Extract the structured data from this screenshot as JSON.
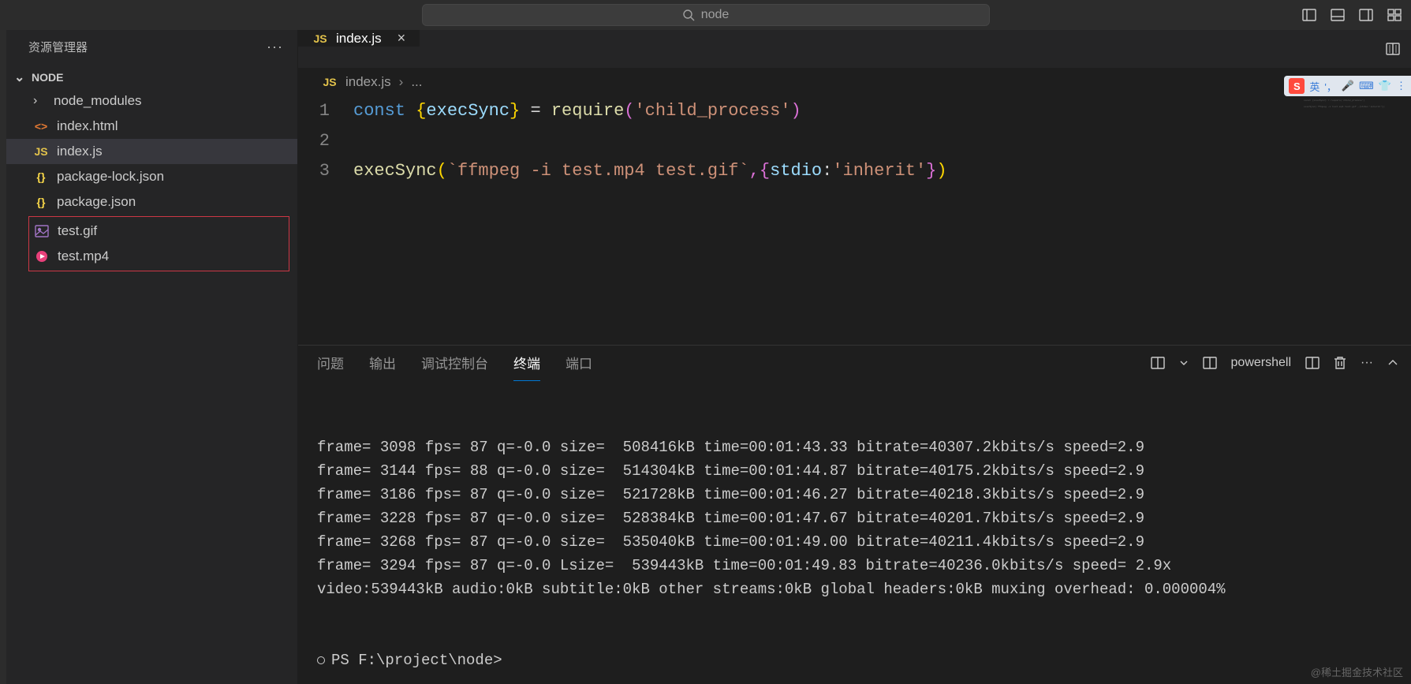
{
  "titlebar": {
    "search_icon": "search",
    "search_text": "node"
  },
  "sidebar": {
    "title": "资源管理器",
    "root_name": "NODE",
    "files": [
      {
        "name": "node_modules",
        "type": "folder",
        "icon": "chevron-right"
      },
      {
        "name": "index.html",
        "type": "html",
        "icon": "<>"
      },
      {
        "name": "index.js",
        "type": "js",
        "icon": "JS",
        "selected": true
      },
      {
        "name": "package-lock.json",
        "type": "json",
        "icon": "{}"
      },
      {
        "name": "package.json",
        "type": "json",
        "icon": "{}"
      }
    ],
    "highlighted_files": [
      {
        "name": "test.gif",
        "type": "image",
        "icon": "img"
      },
      {
        "name": "test.mp4",
        "type": "video",
        "icon": "play"
      }
    ]
  },
  "tabs": [
    {
      "icon": "JS",
      "label": "index.js",
      "active": true
    }
  ],
  "breadcrumbs": {
    "icon": "JS",
    "file": "index.js",
    "rest": "..."
  },
  "code": {
    "lines": [
      {
        "num": "1",
        "tokens": [
          {
            "t": "const ",
            "c": "tok-keyword"
          },
          {
            "t": "{",
            "c": "tok-punct-bracket"
          },
          {
            "t": "execSync",
            "c": "tok-var"
          },
          {
            "t": "}",
            "c": "tok-punct-bracket"
          },
          {
            "t": " = ",
            "c": "tok-punct"
          },
          {
            "t": "require",
            "c": "tok-func"
          },
          {
            "t": "(",
            "c": "tok-punct-paren"
          },
          {
            "t": "'child_process'",
            "c": "tok-string"
          },
          {
            "t": ")",
            "c": "tok-punct-paren"
          }
        ]
      },
      {
        "num": "2",
        "tokens": []
      },
      {
        "num": "3",
        "tokens": [
          {
            "t": "execSync",
            "c": "tok-func"
          },
          {
            "t": "(",
            "c": "tok-punct-bracket"
          },
          {
            "t": "`ffmpeg -i test.mp4 test.gif`",
            "c": "tok-string"
          },
          {
            "t": ",{",
            "c": "tok-punct-paren"
          },
          {
            "t": "stdio",
            "c": "tok-var"
          },
          {
            "t": ":",
            "c": "tok-punct"
          },
          {
            "t": "'inherit'",
            "c": "tok-string"
          },
          {
            "t": "}",
            "c": "tok-punct-paren"
          },
          {
            "t": ")",
            "c": "tok-punct-bracket"
          }
        ]
      }
    ]
  },
  "panel": {
    "tabs": [
      {
        "label": "问题",
        "active": false
      },
      {
        "label": "输出",
        "active": false
      },
      {
        "label": "调试控制台",
        "active": false
      },
      {
        "label": "终端",
        "active": true
      },
      {
        "label": "端口",
        "active": false
      }
    ],
    "shell_label": "powershell",
    "terminal_lines": [
      "frame= 3098 fps= 87 q=-0.0 size=  508416kB time=00:01:43.33 bitrate=40307.2kbits/s speed=2.9",
      "frame= 3144 fps= 88 q=-0.0 size=  514304kB time=00:01:44.87 bitrate=40175.2kbits/s speed=2.9",
      "frame= 3186 fps= 87 q=-0.0 size=  521728kB time=00:01:46.27 bitrate=40218.3kbits/s speed=2.9",
      "frame= 3228 fps= 87 q=-0.0 size=  528384kB time=00:01:47.67 bitrate=40201.7kbits/s speed=2.9",
      "frame= 3268 fps= 87 q=-0.0 size=  535040kB time=00:01:49.00 bitrate=40211.4kbits/s speed=2.9",
      "frame= 3294 fps= 87 q=-0.0 Lsize=  539443kB time=00:01:49.83 bitrate=40236.0kbits/s speed= 2.9x",
      "video:539443kB audio:0kB subtitle:0kB other streams:0kB global headers:0kB muxing overhead: 0.000004%"
    ],
    "prompt": "PS F:\\project\\node>"
  },
  "ime": {
    "badge": "S",
    "text": "英",
    "icons": [
      "mic",
      "grid",
      "shirt",
      "more"
    ]
  },
  "watermark": "@稀土掘金技术社区"
}
